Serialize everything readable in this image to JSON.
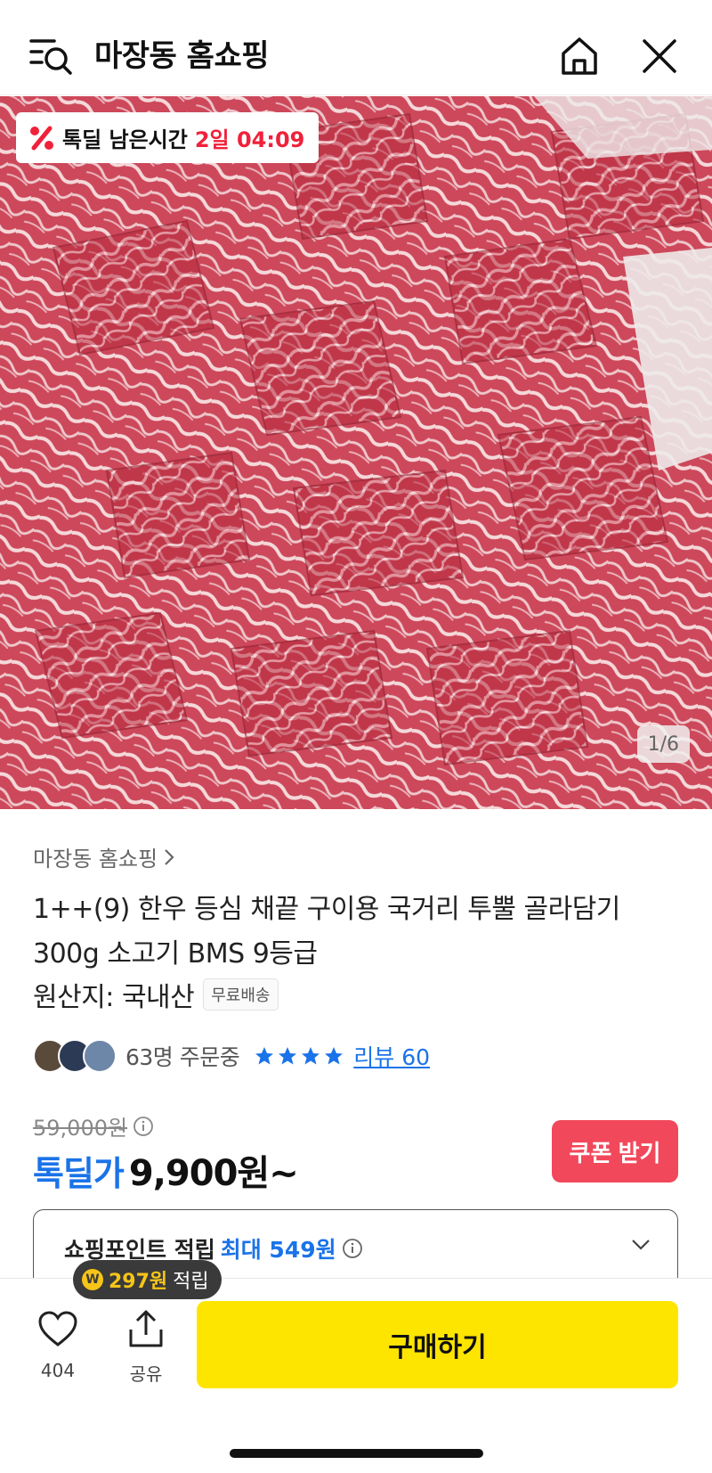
{
  "header": {
    "title": "마장동 홈쇼핑",
    "menu_icon": "menu-search-icon",
    "home_icon": "home-icon",
    "close_icon": "close-icon"
  },
  "hero": {
    "deal_label": "톡딜 남은시간",
    "deal_time": "2일 04:09",
    "image_counter": "1/6"
  },
  "product": {
    "store_name": "마장동 홈쇼핑",
    "title": "1++(9) 한우 등심 채끝 구이용 국거리 투뿔 골라담기 300g 소고기 BMS 9등급",
    "origin": "원산지: 국내산",
    "free_shipping": "무료배송",
    "order_count": "63명 주문중",
    "rating_stars": 4,
    "review_link": "리뷰 60"
  },
  "price": {
    "original": "59,000원",
    "deal_label": "톡딜가",
    "deal_price": "9,900원~",
    "coupon_button": "쿠폰 받기"
  },
  "points": {
    "label": "쇼핑포인트 적립",
    "max": "최대 549원"
  },
  "bottom": {
    "earn_amount": "297원",
    "earn_label": "적립",
    "coin_symbol": "W",
    "like_count": "404",
    "share_label": "공유",
    "buy_button": "구매하기"
  },
  "colors": {
    "accent_blue": "#1a73e8",
    "deal_red": "#f0213a",
    "coupon_red": "#f2485b",
    "buy_yellow": "#fee500"
  }
}
